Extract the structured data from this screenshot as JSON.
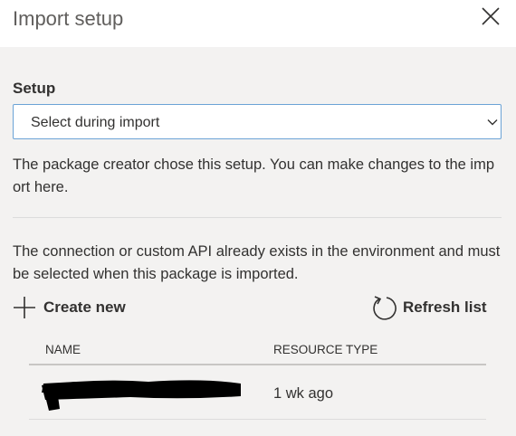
{
  "panel": {
    "title": "Import setup"
  },
  "setup": {
    "label": "Setup",
    "selected_value": "Select during import",
    "description": "The package creator chose this setup. You can make changes to the import here."
  },
  "connection": {
    "description": "The connection or custom API already exists in the environment and must be selected when this package is imported."
  },
  "toolbar": {
    "create_label": "Create new",
    "refresh_label": "Refresh list"
  },
  "table": {
    "columns": [
      "NAME",
      "RESOURCE TYPE"
    ],
    "rows": [
      {
        "name": "",
        "resource_type": "1 wk ago"
      }
    ]
  },
  "icons": {
    "close": "close-icon",
    "chevron": "chevron-down-icon",
    "add": "plus-icon",
    "refresh": "refresh-icon"
  }
}
